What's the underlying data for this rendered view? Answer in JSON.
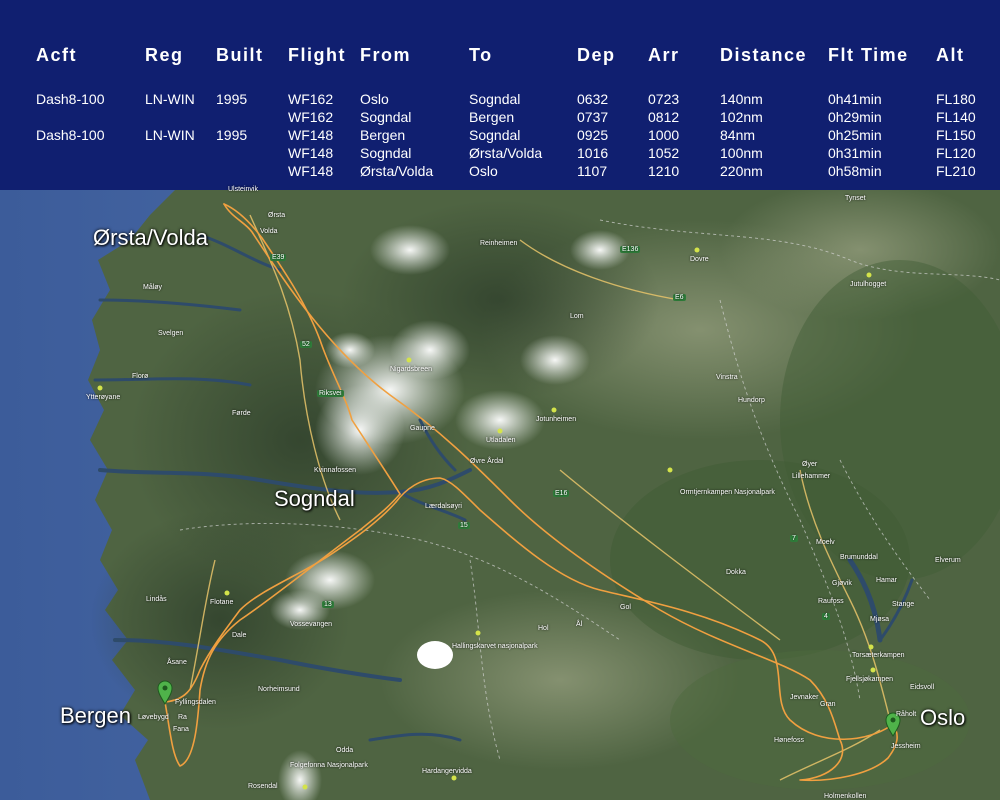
{
  "table": {
    "headers": [
      "Acft",
      "Reg",
      "Built",
      "Flight",
      "From",
      "To",
      "Dep",
      "Arr",
      "Distance",
      "Flt Time",
      "Alt"
    ],
    "rows": [
      [
        "Dash8-100",
        "LN-WIN",
        "1995",
        "WF162",
        "Oslo",
        "Sogndal",
        "0632",
        "0723",
        "140nm",
        "0h41min",
        "FL180"
      ],
      [
        "",
        "",
        "",
        "WF162",
        "Sogndal",
        "Bergen",
        "0737",
        "0812",
        "102nm",
        "0h29min",
        "FL140"
      ],
      [
        "Dash8-100",
        "LN-WIN",
        "1995",
        "WF148",
        "Bergen",
        "Sogndal",
        "0925",
        "1000",
        "84nm",
        "0h25min",
        "FL150"
      ],
      [
        "",
        "",
        "",
        "WF148",
        "Sogndal",
        "Ørsta/Volda",
        "1016",
        "1052",
        "100nm",
        "0h31min",
        "FL120"
      ],
      [
        "",
        "",
        "",
        "WF148",
        "Ørsta/Volda",
        "Oslo",
        "1107",
        "1210",
        "220nm",
        "0h58min",
        "FL210"
      ]
    ]
  },
  "map": {
    "route_color": "#f0a040",
    "cities": {
      "orsta_volda": "Ørsta/Volda",
      "sogndal": "Sogndal",
      "bergen": "Bergen",
      "oslo": "Oslo"
    },
    "places": [
      "Ulsteinvik",
      "Ørsta",
      "Volda",
      "Reinheimen",
      "Dovre",
      "Tynset",
      "Måløy",
      "Svelgen",
      "Florø",
      "Ytterøyane",
      "Førde",
      "Nigardsbreen",
      "Jutulhogget",
      "Lom",
      "Vinstra",
      "Hundorp",
      "Jotunheimen",
      "Gaupne",
      "Utladalen",
      "Øvre Årdal",
      "Kvinnafossen",
      "Lærdalsøyri",
      "Øyer",
      "Lillehammer",
      "Ormtjernkampen Nasjonalpark",
      "Moelv",
      "Brumunddal",
      "Elverum",
      "Hamar",
      "Gjøvik",
      "Raufoss",
      "Stange",
      "Dokka",
      "Flotane",
      "Lindås",
      "Vossevangen",
      "Dale",
      "Hol",
      "Ål",
      "Gol",
      "Åsane",
      "Fyllingsdalen",
      "Hallingskarvet nasjonalpark",
      "Torsæterkampen",
      "Fjellsjøkampen",
      "Eidsvoll",
      "Råholt",
      "Fana",
      "Norheimsund",
      "Jevnaker",
      "Gran",
      "Hønefoss",
      "Jessheim",
      "Odda",
      "Folgefonna Nasjonalpark",
      "Hardangervidda",
      "Holmenkollen",
      "Rosendal",
      "Løvebygd",
      "Mjøsa",
      "Ra"
    ],
    "roads": [
      "E39",
      "E136",
      "E6",
      "E16",
      "15",
      "13",
      "52",
      "4",
      "7",
      "Riksvei"
    ]
  }
}
